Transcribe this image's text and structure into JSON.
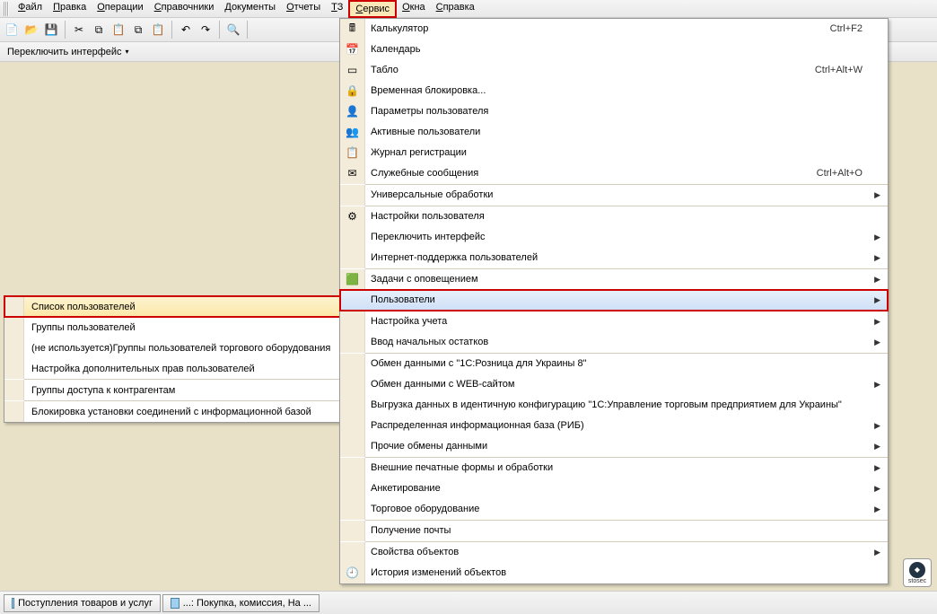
{
  "menubar": {
    "items": [
      "Файл",
      "Правка",
      "Операции",
      "Справочники",
      "Документы",
      "Отчеты",
      "ТЗ",
      "Сервис",
      "Окна",
      "Справка"
    ],
    "active_index": 7
  },
  "switchbar": {
    "label": "Переключить интерфейс"
  },
  "dropdown": [
    {
      "type": "item",
      "label": "Калькулятор",
      "shortcut": "Ctrl+F2",
      "icon": "🖩"
    },
    {
      "type": "item",
      "label": "Календарь",
      "icon": "📅"
    },
    {
      "type": "item",
      "label": "Табло",
      "shortcut": "Ctrl+Alt+W",
      "icon": "▭"
    },
    {
      "type": "item",
      "label": "Временная блокировка...",
      "icon": "🔒"
    },
    {
      "type": "item",
      "label": "Параметры пользователя",
      "icon": "👤"
    },
    {
      "type": "item",
      "label": "Активные пользователи",
      "icon": "👥"
    },
    {
      "type": "item",
      "label": "Журнал регистрации",
      "icon": "📋"
    },
    {
      "type": "item",
      "label": "Служебные сообщения",
      "shortcut": "Ctrl+Alt+O",
      "icon": "✉"
    },
    {
      "type": "div"
    },
    {
      "type": "item",
      "label": "Универсальные обработки",
      "arrow": true
    },
    {
      "type": "div"
    },
    {
      "type": "item",
      "label": "Настройки пользователя",
      "icon": "⚙"
    },
    {
      "type": "item",
      "label": "Переключить интерфейс",
      "arrow": true
    },
    {
      "type": "item",
      "label": "Интернет-поддержка пользователей",
      "arrow": true
    },
    {
      "type": "div"
    },
    {
      "type": "item",
      "label": "Задачи с оповещением",
      "icon": "🟩",
      "arrow": true
    },
    {
      "type": "item",
      "label": "Пользователи",
      "arrow": true,
      "highlight": true,
      "boxed": true
    },
    {
      "type": "div"
    },
    {
      "type": "item",
      "label": "Настройка учета",
      "arrow": true
    },
    {
      "type": "item",
      "label": "Ввод начальных остатков",
      "arrow": true
    },
    {
      "type": "div"
    },
    {
      "type": "item",
      "label": "Обмен данными с \"1С:Розница для Украины 8\""
    },
    {
      "type": "item",
      "label": "Обмен данными с WEB-сайтом",
      "arrow": true
    },
    {
      "type": "item",
      "label": "Выгрузка данных в идентичную конфигурацию \"1С:Управление торговым предприятием для Украины\""
    },
    {
      "type": "item",
      "label": "Распределенная информационная база (РИБ)",
      "arrow": true
    },
    {
      "type": "item",
      "label": "Прочие обмены данными",
      "arrow": true
    },
    {
      "type": "div"
    },
    {
      "type": "item",
      "label": "Внешние печатные формы и обработки",
      "arrow": true
    },
    {
      "type": "item",
      "label": "Анкетирование",
      "arrow": true
    },
    {
      "type": "item",
      "label": "Торговое оборудование",
      "arrow": true
    },
    {
      "type": "div"
    },
    {
      "type": "item",
      "label": "Получение почты"
    },
    {
      "type": "div"
    },
    {
      "type": "item",
      "label": "Свойства объектов",
      "arrow": true
    },
    {
      "type": "item",
      "label": "История изменений объектов",
      "icon": "🕘"
    }
  ],
  "submenu": [
    {
      "type": "item",
      "label": "Список пользователей",
      "highlight": true,
      "boxed": true
    },
    {
      "type": "item",
      "label": "Группы пользователей"
    },
    {
      "type": "item",
      "label": "(не используется)Группы пользователей торгового оборудования"
    },
    {
      "type": "item",
      "label": "Настройка дополнительных прав пользователей"
    },
    {
      "type": "div"
    },
    {
      "type": "item",
      "label": "Группы доступа к контрагентам"
    },
    {
      "type": "div"
    },
    {
      "type": "item",
      "label": "Блокировка установки соединений с информационной базой"
    }
  ],
  "taskbar": [
    {
      "label": "Поступления товаров и услуг"
    },
    {
      "label": "...: Покупка, комиссия, На ..."
    }
  ],
  "logo": {
    "text": "stosec"
  }
}
